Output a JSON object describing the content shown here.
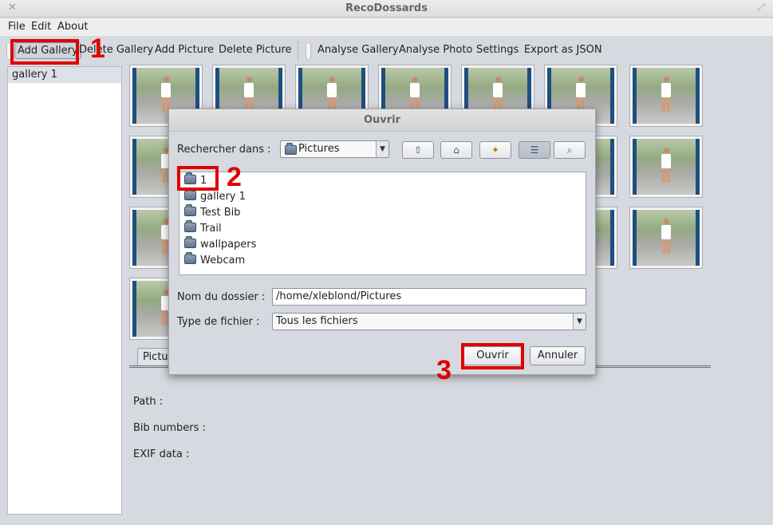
{
  "window": {
    "title": "RecoDossards"
  },
  "menu": [
    "File",
    "Edit",
    "About"
  ],
  "toolbar": {
    "add_gallery": "Add Gallery",
    "delete_gallery": "Delete Gallery",
    "add_picture": "Add Picture",
    "delete_picture": "Delete Picture",
    "analyse_gallery": "Analyse Gallery",
    "analyse_photo": "Analyse Photo",
    "settings": "Settings",
    "export_json": "Export as JSON"
  },
  "sidebar": {
    "items": [
      "gallery 1"
    ]
  },
  "detail_tab": {
    "label": "Pictu"
  },
  "info": {
    "path_label": "Path :",
    "bib_label": "Bib numbers :",
    "exif_label": "EXIF data :"
  },
  "dialog": {
    "title": "Ouvrir",
    "look_in_label": "Rechercher dans :",
    "look_in_value": "Pictures",
    "files": [
      "1",
      "gallery 1",
      "Test Bib",
      "Trail",
      "wallpapers",
      "Webcam"
    ],
    "folder_name_label": "Nom du dossier :",
    "folder_name_value": "/home/xleblond/Pictures",
    "file_type_label": "Type de fichier :",
    "file_type_value": "Tous les fichiers",
    "open_button": "Ouvrir",
    "cancel_button": "Annuler"
  },
  "annotations": [
    "1",
    "2",
    "3"
  ],
  "colors": {
    "annotation": "#e00000",
    "thumb_frame": "#1e4f7e"
  }
}
